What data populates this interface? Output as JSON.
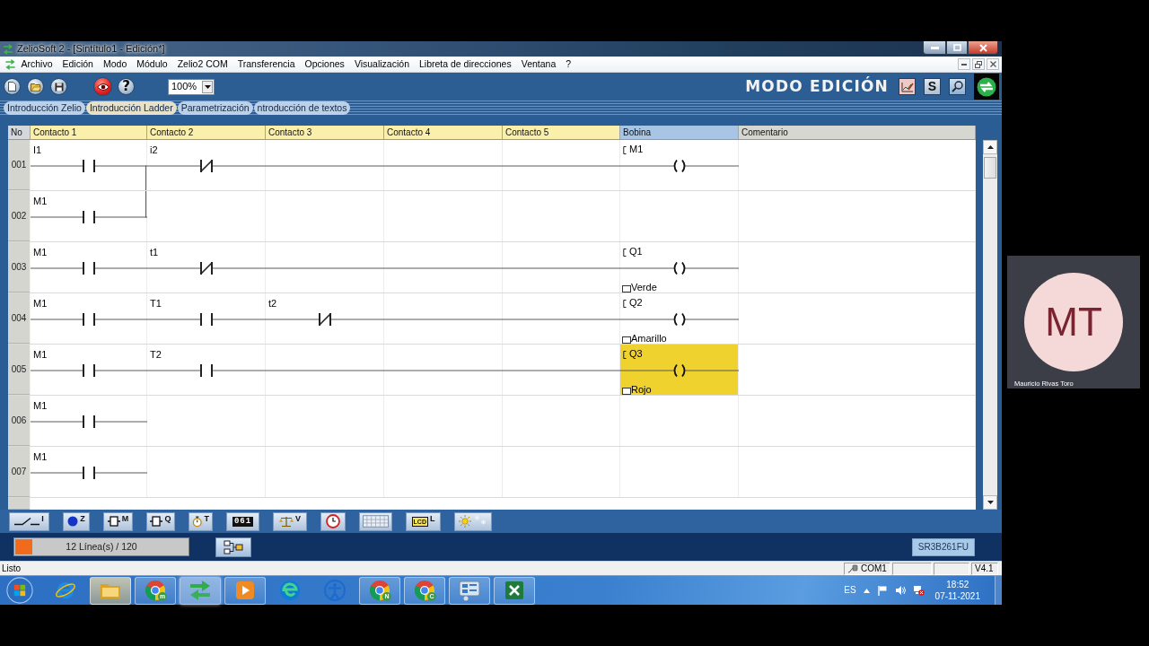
{
  "window": {
    "title": "ZelioSoft 2 - [Sintítulo1 - Edición*]"
  },
  "menu": [
    "Archivo",
    "Edición",
    "Modo",
    "Módulo",
    "Zelio2 COM",
    "Transferencia",
    "Opciones",
    "Visualización",
    "Libreta de direcciones",
    "Ventana",
    "?"
  ],
  "toolbar": {
    "buttons": [
      {
        "kind": "new"
      },
      {
        "kind": "open"
      },
      {
        "kind": "save"
      },
      {
        "kind": "view"
      },
      {
        "kind": "help",
        "label": "?"
      }
    ],
    "zoom": "100%",
    "mode": "MODO EDICIÓN",
    "mode_buttons": [
      {
        "kind": "edit"
      },
      {
        "kind": "simulate",
        "label": "S"
      },
      {
        "kind": "search"
      },
      {
        "kind": "logo"
      }
    ]
  },
  "tabs": [
    {
      "label": "Introducción Zelio",
      "selected": false
    },
    {
      "label": "Introducción Ladder",
      "selected": true
    },
    {
      "label": "Parametrización",
      "selected": false
    },
    {
      "label": "ntroducción de textos",
      "selected": false
    }
  ],
  "ladder": {
    "columns": [
      {
        "label": "No",
        "kind": "number",
        "selected": false
      },
      {
        "label": "Contacto 1",
        "kind": "contact",
        "selected": false
      },
      {
        "label": "Contacto 2",
        "kind": "contact",
        "selected": false
      },
      {
        "label": "Contacto 3",
        "kind": "contact",
        "selected": false
      },
      {
        "label": "Contacto 4",
        "kind": "contact",
        "selected": false
      },
      {
        "label": "Contacto 5",
        "kind": "contact",
        "selected": false
      },
      {
        "label": "Bobina",
        "kind": "coil",
        "selected": true
      },
      {
        "label": "Comentario",
        "kind": "comment",
        "selected": false
      }
    ],
    "rows": [
      {
        "number": "001",
        "joins_above": false,
        "contacts": [
          {
            "kind": "open",
            "label": "I1"
          },
          {
            "kind": "closed",
            "label": "i2"
          },
          {
            "kind": "wire"
          },
          {
            "kind": "wire"
          },
          {
            "kind": "wire"
          }
        ],
        "coil": {
          "label": "M1",
          "selected": false
        }
      },
      {
        "number": "002",
        "joins_above": true,
        "contacts": [
          {
            "kind": "open",
            "label": "M1"
          }
        ]
      },
      {
        "number": "003",
        "joins_above": false,
        "contacts": [
          {
            "kind": "open",
            "label": "M1"
          },
          {
            "kind": "closed",
            "label": "t1"
          },
          {
            "kind": "wire"
          },
          {
            "kind": "wire"
          },
          {
            "kind": "wire"
          }
        ],
        "coil": {
          "label": "Q1",
          "comment": "Verde",
          "selected": false
        }
      },
      {
        "number": "004",
        "joins_above": false,
        "contacts": [
          {
            "kind": "open",
            "label": "M1"
          },
          {
            "kind": "open",
            "label": "T1"
          },
          {
            "kind": "closed",
            "label": "t2"
          },
          {
            "kind": "wire"
          },
          {
            "kind": "wire"
          }
        ],
        "coil": {
          "label": "Q2",
          "comment": "Amarillo",
          "selected": false
        }
      },
      {
        "number": "005",
        "joins_above": false,
        "contacts": [
          {
            "kind": "open",
            "label": "M1"
          },
          {
            "kind": "open",
            "label": "T2"
          },
          {
            "kind": "wire"
          },
          {
            "kind": "wire"
          },
          {
            "kind": "wire"
          }
        ],
        "coil": {
          "label": "Q3",
          "comment": "Rojo",
          "selected": true
        }
      },
      {
        "number": "006",
        "joins_above": false,
        "contacts": [
          {
            "kind": "open",
            "label": "M1"
          }
        ]
      },
      {
        "number": "007",
        "joins_above": false,
        "contacts": [
          {
            "kind": "open",
            "label": "M1"
          }
        ]
      }
    ]
  },
  "palette": [
    {
      "kind": "contact",
      "letter": "I"
    },
    {
      "kind": "coil",
      "letter": "Z"
    },
    {
      "kind": "relay",
      "letter": "M"
    },
    {
      "kind": "output",
      "letter": "Q"
    },
    {
      "kind": "timer",
      "letter": "T"
    },
    {
      "kind": "counter",
      "digits": "061"
    },
    {
      "kind": "compare",
      "letter": "V"
    },
    {
      "kind": "clock"
    },
    {
      "kind": "grid"
    },
    {
      "kind": "lcd",
      "inner": "LCD",
      "letter": "L"
    },
    {
      "kind": "light"
    }
  ],
  "lines": {
    "text": "12 Línea(s) / 120",
    "level": 0.1
  },
  "module": "SR3B261FU",
  "status_bar": {
    "text": "Listo",
    "port": "COM1",
    "version": "V4.1"
  },
  "taskbar": {
    "items": [
      {
        "kind": "ie",
        "running": false,
        "selected": false,
        "highlighted": false
      },
      {
        "kind": "folder",
        "running": true,
        "selected": false,
        "highlighted": true
      },
      {
        "kind": "chrome",
        "badge": "m",
        "running": true,
        "selected": false,
        "highlighted": false
      },
      {
        "kind": "zelio",
        "running": true,
        "selected": true,
        "highlighted": false
      },
      {
        "kind": "media",
        "running": true,
        "selected": false,
        "highlighted": false
      },
      {
        "kind": "edge",
        "running": false,
        "selected": false,
        "highlighted": false
      },
      {
        "kind": "access",
        "running": false,
        "selected": false,
        "highlighted": false
      },
      {
        "kind": "chrome",
        "badge": "N",
        "running": true,
        "selected": false,
        "highlighted": false
      },
      {
        "kind": "chrome",
        "badge": "C",
        "running": true,
        "selected": false,
        "highlighted": false
      },
      {
        "kind": "control",
        "running": true,
        "selected": false,
        "highlighted": false
      },
      {
        "kind": "excel",
        "running": true,
        "selected": false,
        "highlighted": false
      }
    ],
    "language": "ES",
    "time": "18:52",
    "date": "07-11-2021"
  },
  "video_tile": {
    "initials": "MT",
    "name": "Mauricio Rivas Toro"
  }
}
